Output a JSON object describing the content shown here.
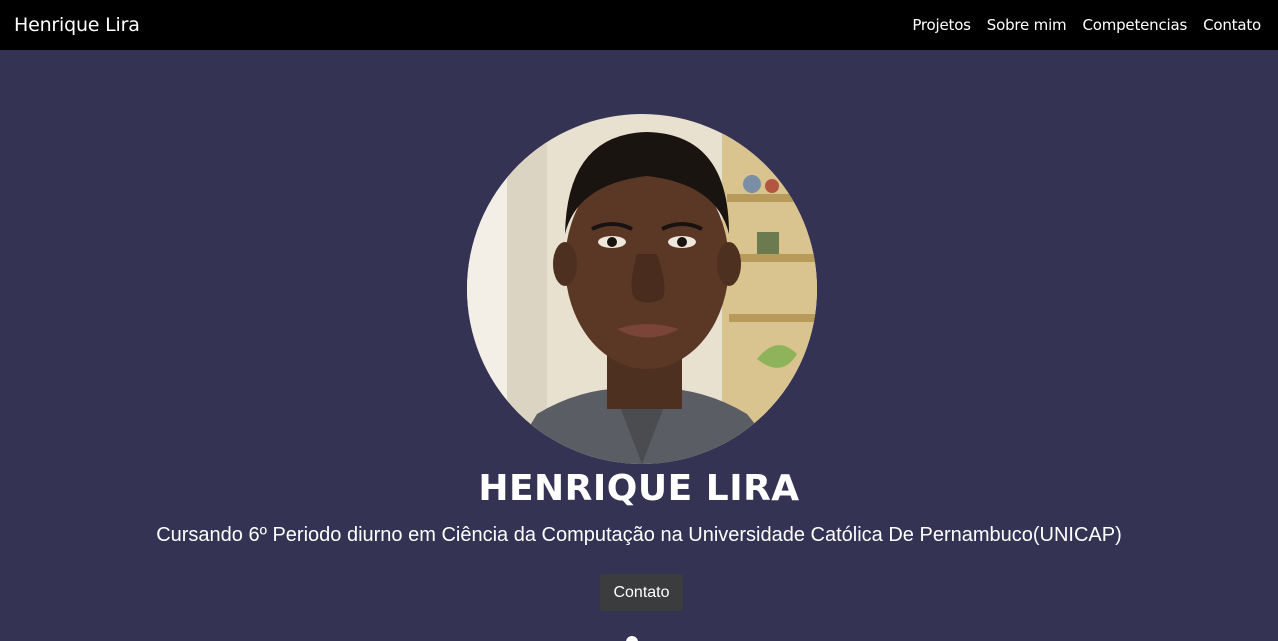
{
  "navbar": {
    "brand": "Henrique Lira",
    "links": [
      "Projetos",
      "Sobre mim",
      "Competencias",
      "Contato"
    ]
  },
  "hero": {
    "name": "HENRIQUE LIRA",
    "subtitle": "Cursando 6º Periodo diurno em Ciência da Computação na Universidade Católica De Pernambuco(UNICAP)",
    "contact_button": "Contato",
    "avatar_alt": "profile-photo"
  },
  "colors": {
    "navbar_bg": "#000000",
    "page_bg": "#343353",
    "button_bg": "#3b3c3e",
    "text": "#ffffff"
  }
}
